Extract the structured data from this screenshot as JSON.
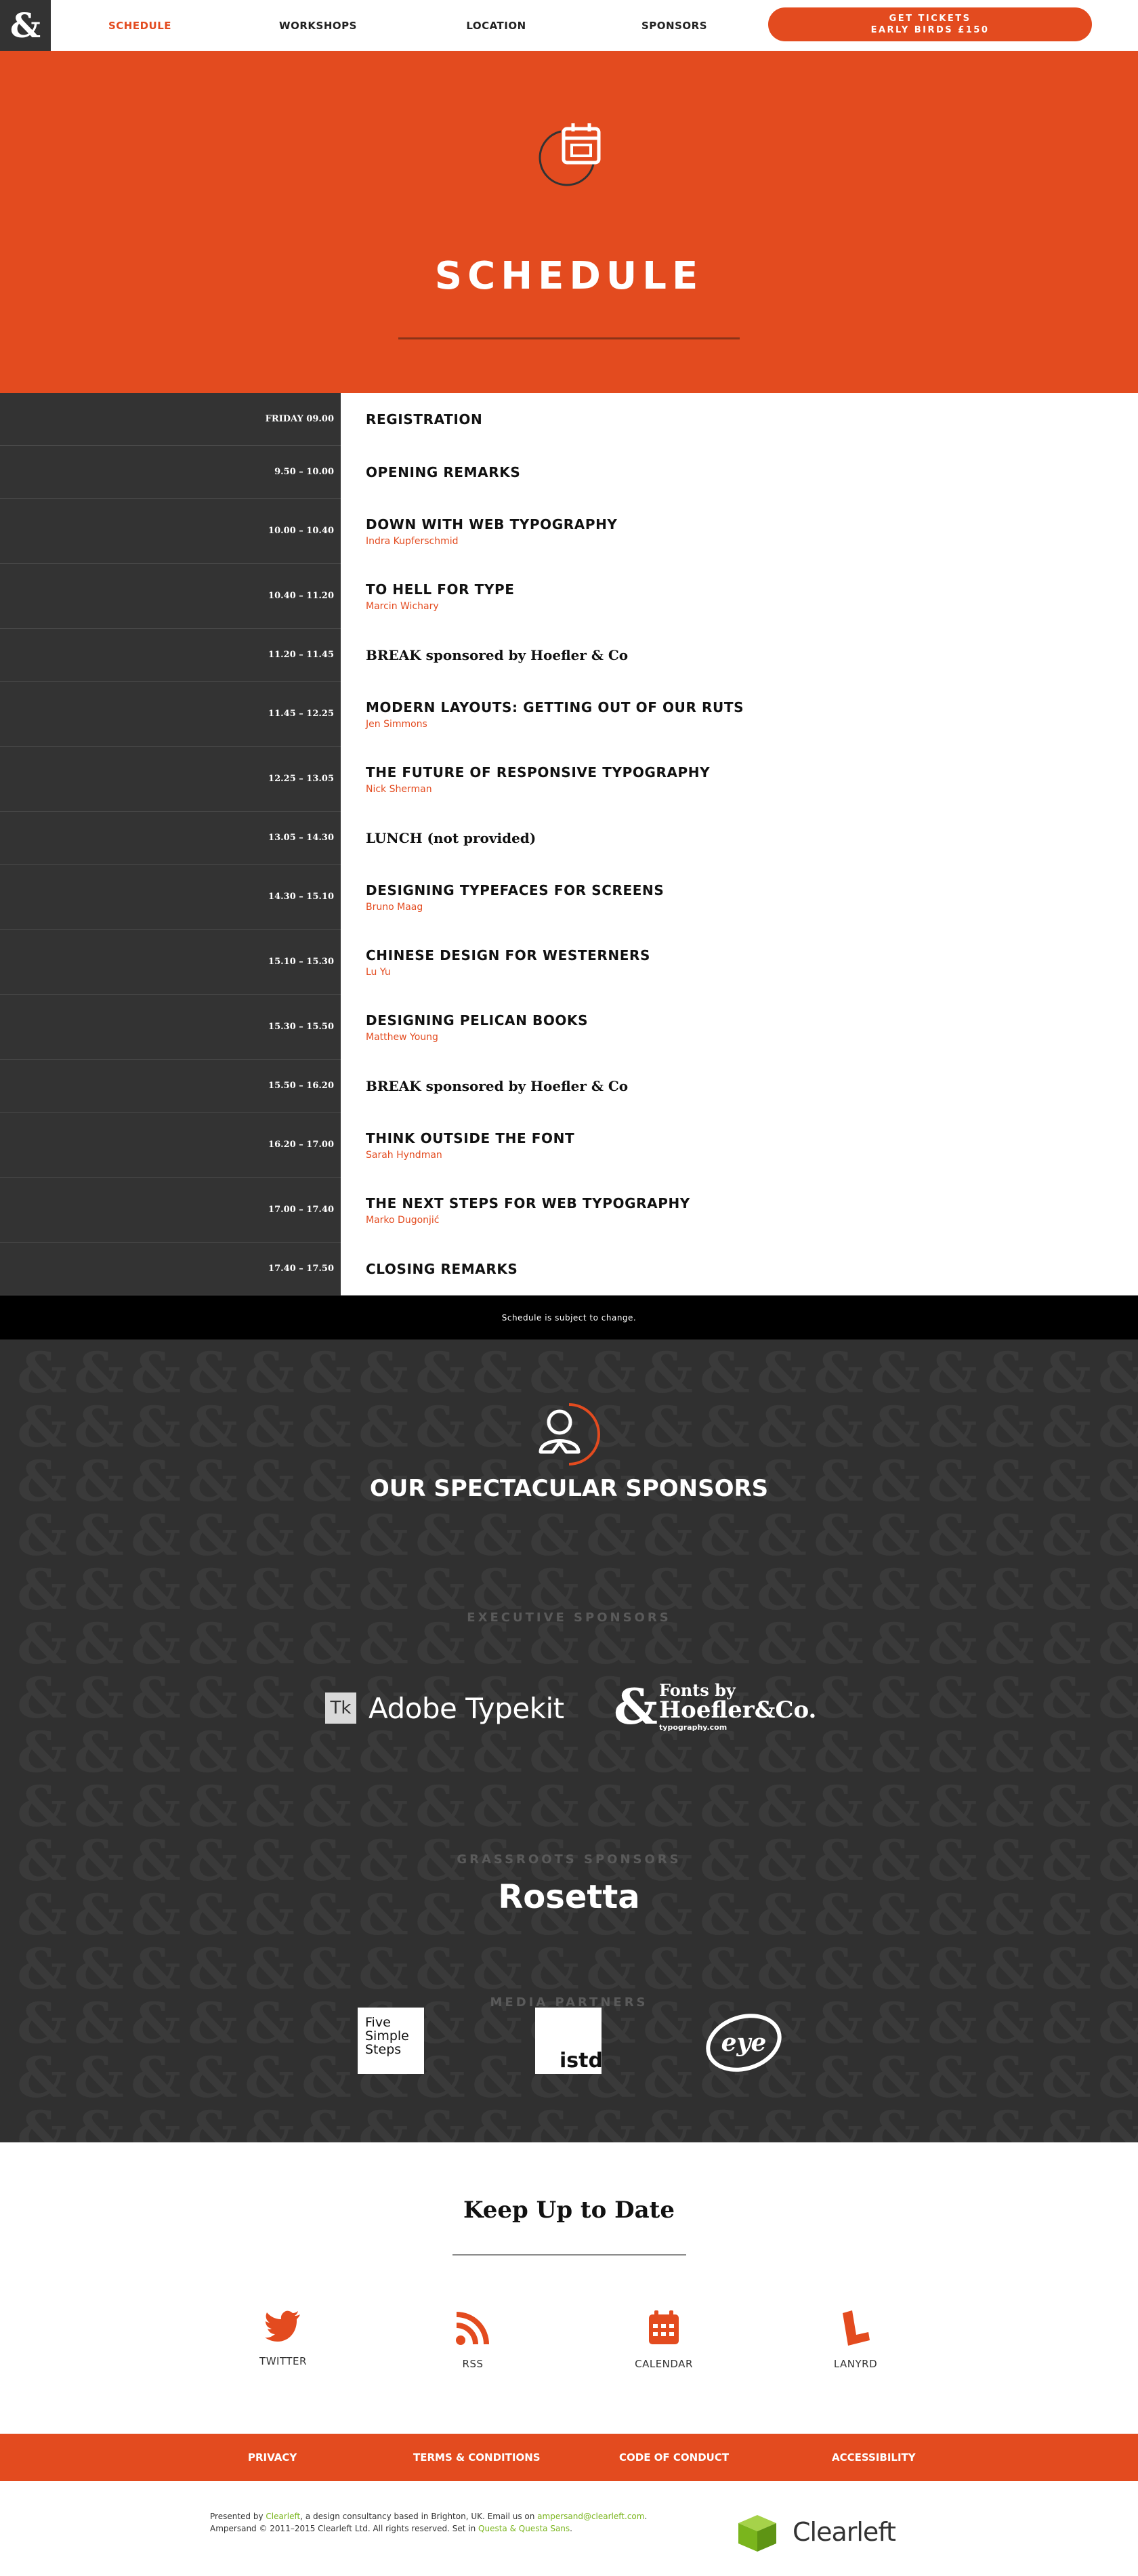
{
  "nav": {
    "logo": "&",
    "items": [
      {
        "label": "SCHEDULE",
        "active": true
      },
      {
        "label": "WORKSHOPS",
        "active": false
      },
      {
        "label": "LOCATION",
        "active": false
      },
      {
        "label": "SPONSORS",
        "active": false
      }
    ],
    "ticket_line1": "GET TICKETS",
    "ticket_line2": "EARLY BIRDS £150"
  },
  "hero": {
    "title": "SCHEDULE",
    "icon": "calendar-icon"
  },
  "schedule": [
    {
      "time": "FRIDAY 09.00",
      "title": "REGISTRATION",
      "speaker": "",
      "break": false
    },
    {
      "time": "9.50 – 10.00",
      "title": "OPENING REMARKS",
      "speaker": "",
      "break": false
    },
    {
      "time": "10.00 – 10.40",
      "title": "DOWN WITH WEB TYPOGRAPHY",
      "speaker": "Indra Kupferschmid",
      "break": false
    },
    {
      "time": "10.40 – 11.20",
      "title": "TO HELL FOR TYPE",
      "speaker": "Marcin Wichary",
      "break": false
    },
    {
      "time": "11.20 – 11.45",
      "title": "BREAK sponsored by Hoefler & Co",
      "speaker": "",
      "break": true
    },
    {
      "time": "11.45 – 12.25",
      "title": "MODERN LAYOUTS: GETTING OUT OF OUR RUTS",
      "speaker": "Jen Simmons",
      "break": false
    },
    {
      "time": "12.25 – 13.05",
      "title": "THE FUTURE OF RESPONSIVE TYPOGRAPHY",
      "speaker": "Nick Sherman",
      "break": false
    },
    {
      "time": "13.05 – 14.30",
      "title": "LUNCH (not provided)",
      "speaker": "",
      "break": true
    },
    {
      "time": "14.30 – 15.10",
      "title": "DESIGNING TYPEFACES FOR SCREENS",
      "speaker": "Bruno Maag",
      "break": false
    },
    {
      "time": "15.10 – 15.30",
      "title": "CHINESE DESIGN FOR WESTERNERS",
      "speaker": "Lu Yu",
      "break": false
    },
    {
      "time": "15.30 – 15.50",
      "title": "DESIGNING PELICAN BOOKS",
      "speaker": "Matthew Young",
      "break": false
    },
    {
      "time": "15.50 – 16.20",
      "title": "BREAK sponsored by Hoefler & Co",
      "speaker": "",
      "break": true
    },
    {
      "time": "16.20 – 17.00",
      "title": "THINK OUTSIDE THE FONT",
      "speaker": "Sarah Hyndman",
      "break": false
    },
    {
      "time": "17.00 – 17.40",
      "title": "THE NEXT STEPS FOR WEB TYPOGRAPHY",
      "speaker": "Marko Dugonjić",
      "break": false
    },
    {
      "time": "17.40 – 17.50",
      "title": "CLOSING REMARKS",
      "speaker": "",
      "break": false
    }
  ],
  "notice": "Schedule is subject to change.",
  "sponsors": {
    "title": "OUR SPECTACULAR SPONSORS",
    "icon": "person-icon",
    "executive_label": "EXECUTIVE SPONSORS",
    "typekit_box": "Tk",
    "typekit_name": "Adobe Typekit",
    "hoefler_amp": "&",
    "hoefler_line1": "Fonts by",
    "hoefler_line2": "Hoefler&Co.",
    "hoefler_line3": "typography.com",
    "grassroots_label": "GRASSROOTS SPONSORS",
    "rosetta": "Rosetta",
    "media_label": "MEDIA PARTNERS",
    "fss_line1": "Five",
    "fss_line2": "Simple",
    "fss_line3": "Steps",
    "istd": "istd",
    "eye": "eye"
  },
  "keep": {
    "title": "Keep Up to Date",
    "links": [
      {
        "label": "TWITTER",
        "icon": "twitter-icon"
      },
      {
        "label": "RSS",
        "icon": "rss-icon"
      },
      {
        "label": "CALENDAR",
        "icon": "calendar-icon"
      },
      {
        "label": "LANYRD",
        "icon": "lanyrd-icon"
      }
    ]
  },
  "footer": {
    "links": [
      "PRIVACY",
      "TERMS & CONDITIONS",
      "CODE OF CONDUCT",
      "ACCESSIBILITY"
    ],
    "presented_prefix": "Presented by ",
    "presented_link": "Clearleft",
    "presented_mid": ", a design consultancy based in Brighton, UK. Email us on ",
    "email": "ampersand@clearleft.com",
    "presented_end": ".",
    "copyright_prefix": "Ampersand © 2011–2015 Clearleft Ltd. All rights reserved. Set in ",
    "font_link": "Questa & Questa Sans",
    "copyright_end": ".",
    "clearleft": "Clearleft"
  },
  "colors": {
    "accent": "#e34b1f",
    "dark": "#333333",
    "green": "#7ab51d"
  }
}
